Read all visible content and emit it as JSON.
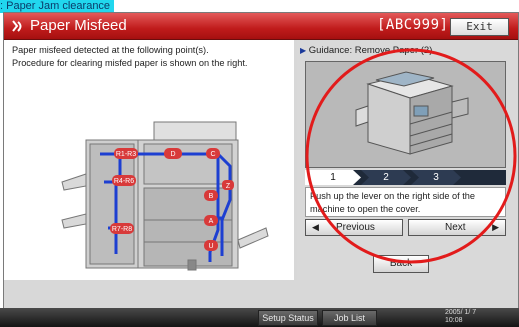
{
  "caption": ": Paper Jam clearance",
  "header": {
    "title": "Paper Misfeed",
    "job_code": "[ABC999]",
    "exit_label": "Exit"
  },
  "message": {
    "line1": "Paper misfeed detected at the following point(s).",
    "line2": "Procedure for clearing misfed paper is shown on the right."
  },
  "misfeed_points": [
    "R1-R3",
    "D",
    "C",
    "R4-R6",
    "Z",
    "B",
    "R7-R8",
    "A",
    "U"
  ],
  "guidance": {
    "label": "Guidance: Remove Paper (2)",
    "steps": [
      "1",
      "2",
      "3"
    ],
    "instruction_line1": "Push up the lever on the right side of the",
    "instruction_line2": "machine to open the cover.",
    "previous_label": "Previous",
    "next_label": "Next",
    "back_label": "Back"
  },
  "status_bar": {
    "setup_status": "Setup Status",
    "job_list": "Job List",
    "date": "2005/ 1/ 7",
    "time": "10:08"
  },
  "colors": {
    "titlebar": "#c01b1b",
    "feed_path": "#1d3fd1",
    "marker": "#d83a3a",
    "highlight_circle": "#e21b1b",
    "caption_bg": "#21d7ee"
  }
}
